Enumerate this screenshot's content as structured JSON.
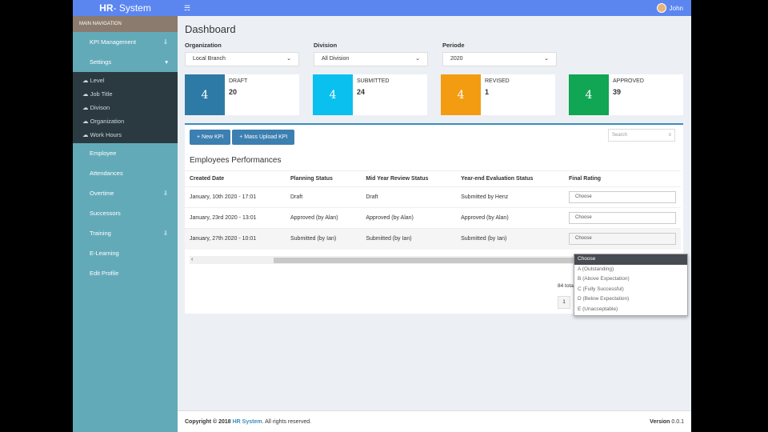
{
  "header": {
    "logo_bold": "HR",
    "logo_rest": "- System",
    "menu_icon": "☴",
    "user": "John"
  },
  "sidebar": {
    "heading": "MAIN NAVIGATION",
    "items": [
      {
        "label": "KPI Management",
        "chevron": "⇩"
      },
      {
        "label": "Settings",
        "chevron": "▾"
      }
    ],
    "settings_sub": [
      "Level",
      "Job Title",
      "Divison",
      "Organization",
      "Work Hours"
    ],
    "items2": [
      {
        "label": "Employee",
        "chevron": ""
      },
      {
        "label": "Attendances",
        "chevron": ""
      },
      {
        "label": "Overtime",
        "chevron": "⇩"
      },
      {
        "label": "Successors",
        "chevron": ""
      },
      {
        "label": "Training",
        "chevron": "⇩"
      },
      {
        "label": "E-Learning",
        "chevron": ""
      },
      {
        "label": "Edit Profile",
        "chevron": ""
      }
    ]
  },
  "page": {
    "title": "Dashboard"
  },
  "filters": [
    {
      "label": "Organization",
      "value": "Local Branch"
    },
    {
      "label": "Division",
      "value": "All Division"
    },
    {
      "label": "Periode",
      "value": "2020"
    }
  ],
  "stats": [
    {
      "icon": "4",
      "label": "DRAFT",
      "value": "20",
      "color": "#2e7aa6"
    },
    {
      "icon": "4",
      "label": "SUBMITTED",
      "value": "24",
      "color": "#0ac0ef"
    },
    {
      "icon": "4",
      "label": "REVISED",
      "value": "1",
      "color": "#f39c12"
    },
    {
      "icon": "4",
      "label": "APPROVED",
      "value": "39",
      "color": "#10a653"
    }
  ],
  "toolbar": {
    "new_kpi": "+ New KPI",
    "mass_upload": "+ Mass Upload KPI",
    "search_placeholder": "Search",
    "search_icon": "≡"
  },
  "table": {
    "title": "Employees Performances",
    "headers": [
      "Created Date",
      "Planning Status",
      "Mid Year Review Status",
      "Year-end Evaluation Status",
      "Final Rating"
    ],
    "rows": [
      [
        "January, 10th 2020 - 17:01",
        "Draft",
        "Draft",
        "Submitted by Henz",
        "Choose"
      ],
      [
        "January, 23rd 2020 - 13:01",
        "Approved (by Alan)",
        "Approved (by Alan)",
        "Approved (by Alan)",
        "Choose"
      ],
      [
        "January, 27th 2020 - 10:01",
        "Submitted (by Ian)",
        "Submitted (by Ian)",
        "Submitted (by Ian)",
        "Choose"
      ]
    ]
  },
  "pagination": {
    "total": "84 total",
    "page": "1"
  },
  "dropdown": {
    "options": [
      "Choose",
      "A (Outstanding)",
      "B (Above Expectation)",
      "C (Fully Successful)",
      "D (Below Expectation)",
      "E (Unacceptable)"
    ]
  },
  "footer": {
    "copyright": "Copyright © 2018 ",
    "brand": "HR System",
    "rights": ". All rights reserved.",
    "version_label": "Version",
    "version": "0.0.1"
  }
}
